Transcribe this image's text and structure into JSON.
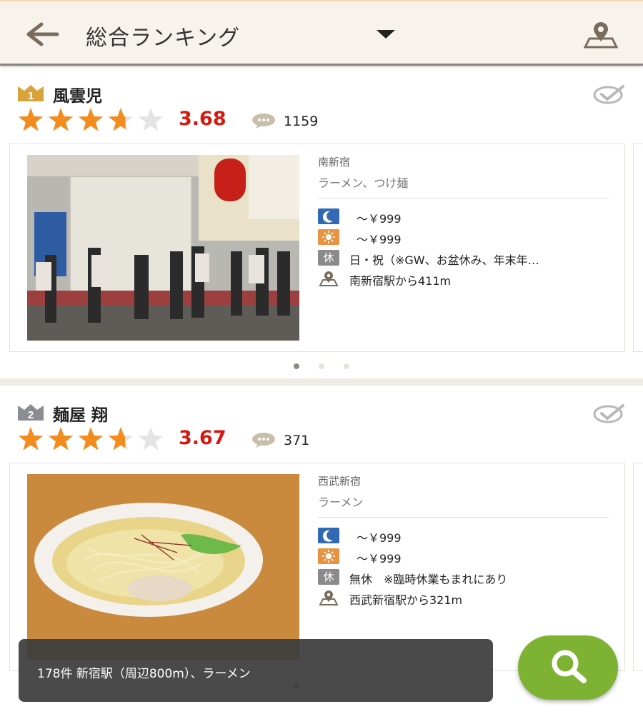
{
  "header": {
    "title": "総合ランキング",
    "back_icon": "arrow-left-icon",
    "dropdown_icon": "caret-down-icon",
    "map_icon": "map-pin-icon"
  },
  "colors": {
    "score": "#d41a10",
    "star": "#f28c1e",
    "fab": "#7db232",
    "dinner_icon": "#3169b2",
    "lunch_icon": "#e79342"
  },
  "shops": [
    {
      "rank": "1",
      "name": "風雲児",
      "rating": 3.68,
      "rating_text": "3.68",
      "reviews": "1159",
      "station": "南新宿",
      "genre": "ラーメン、つけ麺",
      "dinner_price": "～￥999",
      "lunch_price": "～￥999",
      "holiday_label": "休",
      "holiday": "日・祝（※GW、お盆休み、年末年…",
      "distance": "南新宿駅から411m",
      "carousel_pages": 3,
      "carousel_active": 1
    },
    {
      "rank": "2",
      "name": "麺屋 翔",
      "rating": 3.67,
      "rating_text": "3.67",
      "reviews": "371",
      "station": "西武新宿",
      "genre": "ラーメン",
      "dinner_price": "～￥999",
      "lunch_price": "～￥999",
      "holiday_label": "休",
      "holiday": "無休　※臨時休業もまれにあり",
      "distance": "西武新宿駅から321m",
      "carousel_pages": 3,
      "carousel_active": 1
    }
  ],
  "snackbar": {
    "text": "178件 新宿駅（周辺800m）、ラーメン"
  },
  "fab": {
    "icon": "search-icon"
  }
}
